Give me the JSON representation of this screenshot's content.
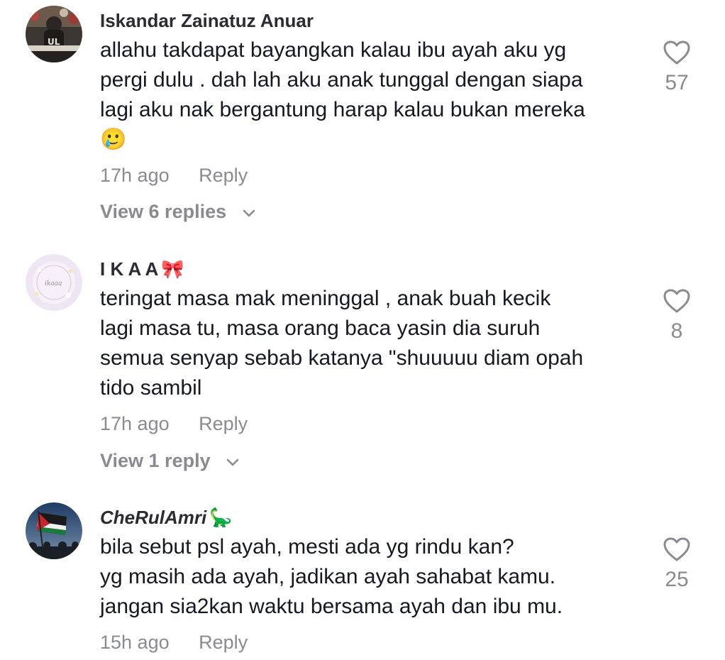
{
  "comments": [
    {
      "username": "Iskandar Zainatuz Anuar",
      "lines": [
        "allahu takdapat bayangkan kalau ibu ayah aku yg",
        "pergi dulu . dah lah aku anak tunggal dengan siapa",
        "lagi aku nak bergantung harap kalau bukan mereka"
      ],
      "trailing_emoji": "🥲",
      "time": "17h ago",
      "reply_label": "Reply",
      "view_replies": "View 6 replies",
      "likes": "57"
    },
    {
      "username": "I K A A",
      "username_emoji": "🎀",
      "lines": [
        "teringat masa mak meninggal , anak buah kecik",
        "lagi masa tu, masa orang baca yasin dia suruh",
        "semua senyap sebab katanya \"shuuuuu diam opah",
        "tido sambil"
      ],
      "time": "17h ago",
      "reply_label": "Reply",
      "view_replies": "View 1 reply",
      "likes": "8"
    },
    {
      "username": "CheRulAmri",
      "username_emoji": "🦕",
      "lines": [
        "bila sebut psl ayah, mesti ada yg rindu kan?",
        "yg masih ada ayah, jadikan ayah sahabat kamu.",
        "jangan sia2kan waktu bersama ayah dan ibu mu."
      ],
      "time": "15h ago",
      "reply_label": "Reply",
      "likes": "25"
    }
  ],
  "colors": {
    "text": "#161823",
    "muted": "#8a8b91",
    "username": "#2b2b33"
  }
}
